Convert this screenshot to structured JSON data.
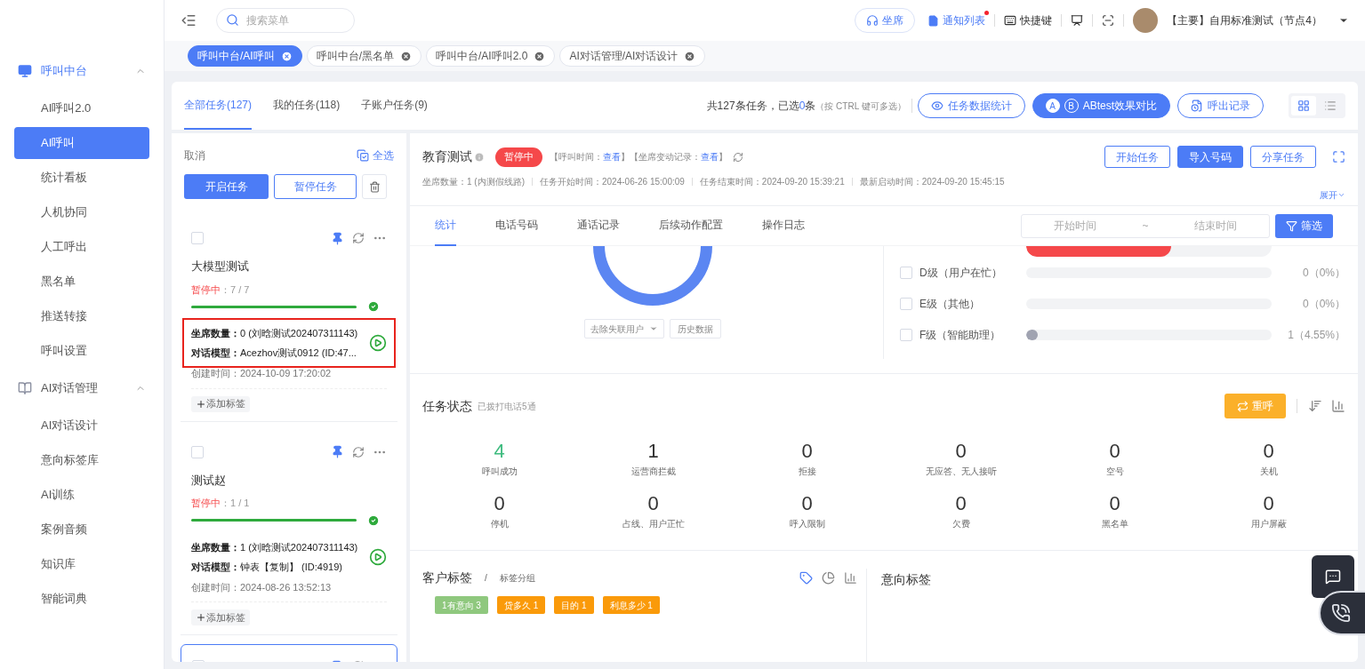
{
  "sidebar": {
    "groups": [
      {
        "label": "呼叫中台",
        "expanded": true,
        "items": [
          {
            "label": "AI呼叫2.0",
            "selected": false
          },
          {
            "label": "AI呼叫",
            "selected": true
          },
          {
            "label": "统计看板",
            "selected": false
          },
          {
            "label": "人机协同",
            "selected": false
          },
          {
            "label": "人工呼出",
            "selected": false
          },
          {
            "label": "黑名单",
            "selected": false
          },
          {
            "label": "推送转接",
            "selected": false
          },
          {
            "label": "呼叫设置",
            "selected": false
          }
        ]
      },
      {
        "label": "AI对话管理",
        "expanded": true,
        "items": [
          {
            "label": "AI对话设计",
            "selected": false
          },
          {
            "label": "意向标签库",
            "selected": false
          },
          {
            "label": "AI训练",
            "selected": false
          },
          {
            "label": "案例音频",
            "selected": false
          },
          {
            "label": "知识库",
            "selected": false
          },
          {
            "label": "智能词典",
            "selected": false
          }
        ]
      }
    ]
  },
  "header": {
    "search": {
      "placeholder": "搜索菜单"
    },
    "seat_button": "坐席",
    "notifications": {
      "label": "通知列表",
      "unread": true
    },
    "shortcuts": "快捷键",
    "account": "【主要】自用标准测试（节点4）"
  },
  "open_tabs": [
    {
      "label": "呼叫中台/AI呼叫",
      "selected": true
    },
    {
      "label": "呼叫中台/黑名单",
      "selected": false
    },
    {
      "label": "呼叫中台/AI呼叫2.0",
      "selected": false
    },
    {
      "label": "AI对话管理/AI对话设计",
      "selected": false
    }
  ],
  "task_tabs": [
    {
      "label": "全部任务(127)",
      "selected": true
    },
    {
      "label": "我的任务(118)",
      "selected": false
    },
    {
      "label": "子账户任务(9)",
      "selected": false
    }
  ],
  "summary": {
    "prefix": "共127条任务，已选",
    "count": "0",
    "suffix": "条",
    "hint": "（按 CTRL 键可多选）"
  },
  "toolbar_buttons": [
    {
      "kind": "stats",
      "label": "任务数据统计"
    },
    {
      "kind": "ab",
      "label": "ABtest效果对比",
      "letters": [
        "A",
        "B"
      ]
    },
    {
      "kind": "records",
      "label": "呼出记录"
    }
  ],
  "view_modes": [
    {
      "kind": "grid",
      "selected": true
    },
    {
      "kind": "list",
      "selected": false
    }
  ],
  "task_list": {
    "cancel": "取消",
    "select_all": "全选",
    "start_button": "开启任务",
    "pause_button": "暂停任务",
    "cards": [
      {
        "selected": false,
        "highlighted": true,
        "title": "大模型测试",
        "status": "暂停中",
        "progress": "：7 / 7",
        "level": 1,
        "lines": [
          {
            "label": "坐席数量：",
            "value": "0 (刘晗测试202407311143)"
          },
          {
            "label": "对话模型：",
            "value": "Acezhov测试0912 (ID:47..."
          }
        ],
        "created_label": "创建时间：",
        "created": "2024-10-09 17:20:02",
        "add_tag": "添加标签"
      },
      {
        "selected": false,
        "highlighted": false,
        "title": "测试赵",
        "status": "暂停中",
        "progress": "：1 / 1",
        "level": 1,
        "lines": [
          {
            "label": "坐席数量：",
            "value": "1 (刘晗测试202407311143)"
          },
          {
            "label": "对话模型：",
            "value": "钟表【复制】 (ID:4919)"
          }
        ],
        "created_label": "创建时间：",
        "created": "2024-08-26 13:52:13",
        "add_tag": "添加标签"
      },
      {
        "selected": true
      }
    ]
  },
  "detail": {
    "title": "教育测试",
    "status": "暂停中",
    "links": [
      {
        "prefix": "【呼叫时间：",
        "link": "查看",
        "suffix": "】"
      },
      {
        "prefix": "【坐席变动记录：",
        "link": "查看",
        "suffix": "】"
      }
    ],
    "meta": [
      "坐席数量：1 (内测假线路)",
      "任务开始时间：2024-06-26 15:00:09",
      "任务结束时间：2024-09-20 15:39:21",
      "最新启动时间：2024-09-20 15:45:15"
    ],
    "buttons": [
      {
        "label": "开始任务",
        "primary": false
      },
      {
        "label": "导入号码",
        "primary": true
      },
      {
        "label": "分享任务",
        "primary": false
      }
    ],
    "expand": "展开",
    "tabs": [
      {
        "label": "统计",
        "selected": true
      },
      {
        "label": "电话号码",
        "selected": false
      },
      {
        "label": "通话记录",
        "selected": false
      },
      {
        "label": "后续动作配置",
        "selected": false
      },
      {
        "label": "操作日志",
        "selected": false
      }
    ],
    "date_range": {
      "start_placeholder": "开始时间",
      "separator": "~",
      "end_placeholder": "结束时间"
    },
    "filter_button": "筛选",
    "donut_controls": {
      "dropdown": "去除失联用户",
      "history": "历史数据"
    },
    "clipped_bar": {
      "level": 0.59,
      "color": "#f5484a"
    },
    "grade_rows": [
      {
        "checked": false,
        "label": "D级（用户在忙）",
        "reading": "0（0%）"
      },
      {
        "checked": false,
        "label": "E级（其他）",
        "reading": "0（0%）"
      },
      {
        "checked": false,
        "label": "F级（智能助理）",
        "level": 0.0455,
        "reading": "1（4.55%）"
      }
    ],
    "task_status": {
      "title": "任务状态",
      "subtitle": "已拨打电话5通",
      "redial": "重呼",
      "stats": [
        {
          "value": "4",
          "label": "呼叫成功",
          "color": "#3dbb7e"
        },
        {
          "value": "1",
          "label": "运营商拦截",
          "color": "#333333"
        },
        {
          "value": "0",
          "label": "拒接",
          "color": "#333333"
        },
        {
          "value": "0",
          "label": "无应答、无人接听",
          "color": "#333333"
        },
        {
          "value": "0",
          "label": "空号",
          "color": "#333333"
        },
        {
          "value": "0",
          "label": "关机",
          "color": "#333333"
        },
        {
          "value": "0",
          "label": "停机",
          "color": "#333333"
        },
        {
          "value": "0",
          "label": "占线、用户正忙",
          "color": "#333333"
        },
        {
          "value": "0",
          "label": "呼入限制",
          "color": "#333333"
        },
        {
          "value": "0",
          "label": "欠费",
          "color": "#333333"
        },
        {
          "value": "0",
          "label": "黑名单",
          "color": "#333333"
        },
        {
          "value": "0",
          "label": "用户屏蔽",
          "color": "#333333"
        }
      ]
    },
    "customer_tags": {
      "title": "客户标签",
      "separator": "/",
      "subtitle": "标签分组",
      "tags": [
        {
          "label": "1有意向 3",
          "color": "#8fc87e"
        },
        {
          "label": "贷多久 1",
          "color": "#fa9a0a"
        },
        {
          "label": "目的 1",
          "color": "#fa9a0a"
        },
        {
          "label": "利息多少 1",
          "color": "#fa9a0a"
        }
      ]
    },
    "intent_tags": {
      "title": "意向标签"
    }
  }
}
